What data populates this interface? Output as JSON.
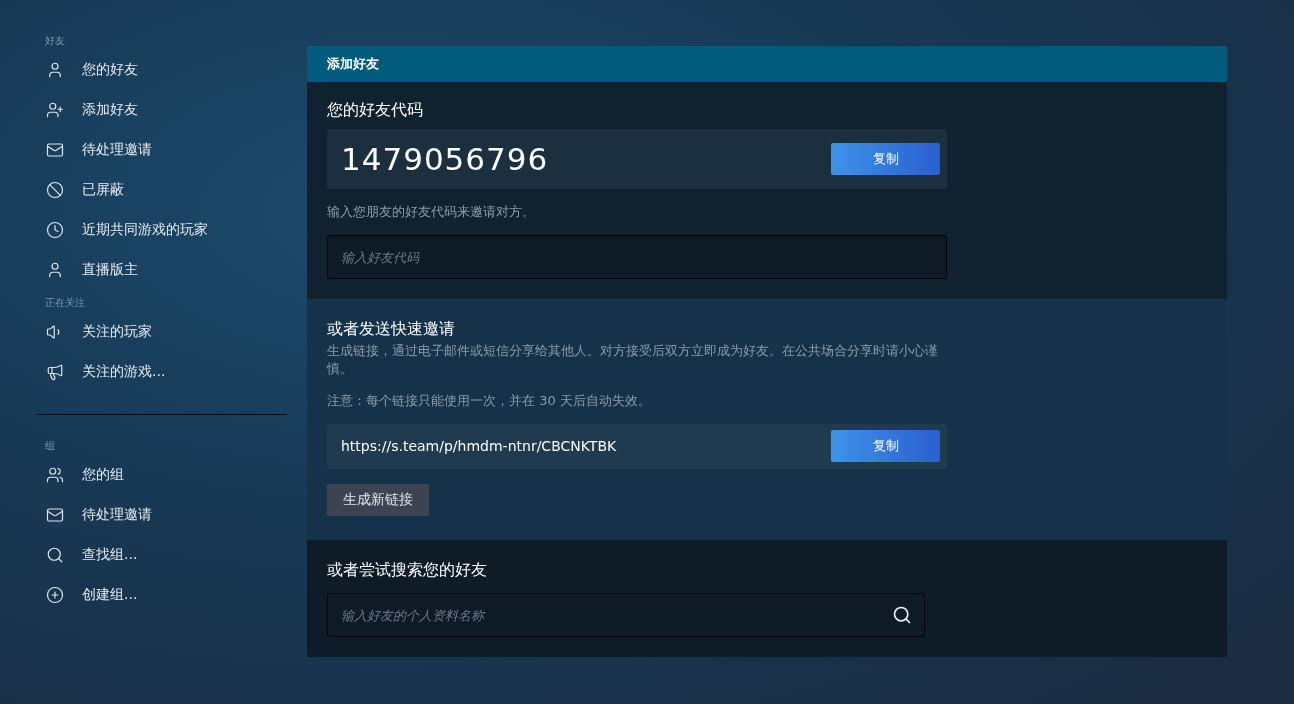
{
  "sidebar": {
    "sections": [
      {
        "heading": "好友",
        "items": [
          {
            "label": "您的好友",
            "kind": "person"
          },
          {
            "label": "添加好友",
            "kind": "person-add"
          },
          {
            "label": "待处理邀请",
            "kind": "mail"
          },
          {
            "label": "已屏蔽",
            "kind": "blocked"
          },
          {
            "label": "近期共同游戏的玩家",
            "kind": "clock"
          },
          {
            "label": "直播版主",
            "kind": "person"
          }
        ]
      },
      {
        "heading": "正在关注",
        "items": [
          {
            "label": "关注的玩家",
            "kind": "person-sound"
          },
          {
            "label": "关注的游戏...",
            "kind": "megaphone"
          }
        ]
      },
      {
        "heading": "组",
        "divider": true,
        "items": [
          {
            "label": "您的组",
            "kind": "group"
          },
          {
            "label": "待处理邀请",
            "kind": "mail"
          },
          {
            "label": "查找组...",
            "kind": "search"
          },
          {
            "label": "创建组...",
            "kind": "plus"
          }
        ]
      }
    ]
  },
  "panel": {
    "title": "添加好友",
    "friend_code": {
      "heading": "您的好友代码",
      "code": "1479056796",
      "copy_button": "复制",
      "hint": "输入您朋友的好友代码来邀请对方。",
      "input": {
        "placeholder": "输入好友代码"
      }
    },
    "quick_invite": {
      "heading": "或者发送快速邀请",
      "description": "生成链接，通过电子邮件或短信分享给其他人。对方接受后双方立即成为好友。在公共场合分享时请小心谨慎。",
      "note": "注意：每个链接只能使用一次，并在 30 天后自动失效。",
      "link": "https://s.team/p/hmdm-ntnr/CBCNKTBK",
      "copy_button": "复制",
      "new_link_button": "生成新链接"
    },
    "search": {
      "heading": "或者尝试搜索您的好友",
      "input": {
        "placeholder": "输入好友的个人资料名称"
      }
    }
  }
}
